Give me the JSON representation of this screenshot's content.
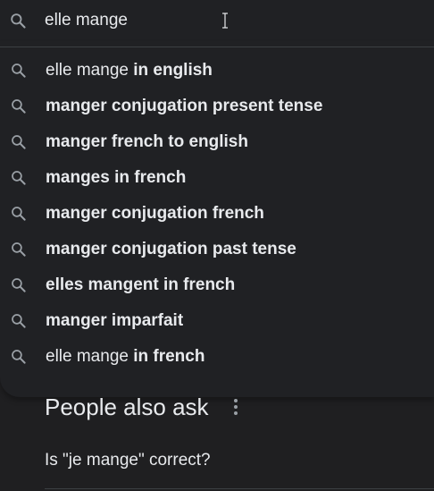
{
  "search": {
    "value": "elle mange",
    "icon": "search-icon"
  },
  "suggestions": [
    {
      "normal": "elle mange ",
      "bold": "in english"
    },
    {
      "normal": "",
      "bold": "manger conjugation present tense"
    },
    {
      "normal": "",
      "bold": "manger french to english"
    },
    {
      "normal": "",
      "bold": "manges in french"
    },
    {
      "normal": "",
      "bold": "manger conjugation french"
    },
    {
      "normal": "",
      "bold": "manger conjugation past tense"
    },
    {
      "normal": "",
      "bold": "elles mangent in french"
    },
    {
      "normal": "",
      "bold": "manger imparfait"
    },
    {
      "normal": "elle mange ",
      "bold": "in french"
    }
  ],
  "people_also_ask": {
    "title": "People also ask",
    "questions": [
      "Is \"je mange\" correct?"
    ]
  },
  "colors": {
    "background": "#1f1f21",
    "text": "#e8eaed",
    "icon": "#9aa0a6",
    "divider": "#3c4043"
  }
}
